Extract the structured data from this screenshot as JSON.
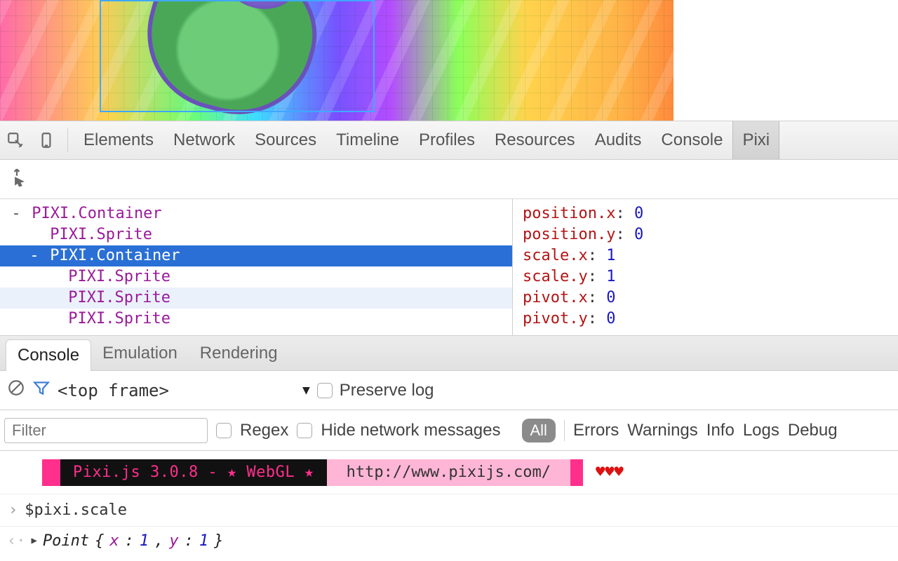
{
  "tabs": {
    "elements": "Elements",
    "network": "Network",
    "sources": "Sources",
    "timeline": "Timeline",
    "profiles": "Profiles",
    "resources": "Resources",
    "audits": "Audits",
    "console": "Console",
    "pixi": "Pixi"
  },
  "tree": [
    {
      "indent": 0,
      "toggle": "-",
      "label": "PIXI.Container",
      "state": ""
    },
    {
      "indent": 1,
      "toggle": " ",
      "label": "PIXI.Sprite",
      "state": ""
    },
    {
      "indent": 1,
      "toggle": "-",
      "label": "PIXI.Container",
      "state": "sel"
    },
    {
      "indent": 2,
      "toggle": " ",
      "label": "PIXI.Sprite",
      "state": ""
    },
    {
      "indent": 2,
      "toggle": " ",
      "label": "PIXI.Sprite",
      "state": "hover"
    },
    {
      "indent": 2,
      "toggle": " ",
      "label": "PIXI.Sprite",
      "state": ""
    }
  ],
  "props": [
    {
      "k": "position.x",
      "v": "0"
    },
    {
      "k": "position.y",
      "v": "0"
    },
    {
      "k": "scale.x",
      "v": "1"
    },
    {
      "k": "scale.y",
      "v": "1"
    },
    {
      "k": "pivot.x",
      "v": "0"
    },
    {
      "k": "pivot.y",
      "v": "0"
    }
  ],
  "drawer_tabs": {
    "console": "Console",
    "emulation": "Emulation",
    "rendering": "Rendering"
  },
  "console_toolbar": {
    "frame": "<top frame>",
    "preserve_log": "Preserve log"
  },
  "console_filters": {
    "filter_placeholder": "Filter",
    "regex": "Regex",
    "hide_net": "Hide network messages",
    "levels": {
      "all": "All",
      "errors": "Errors",
      "warnings": "Warnings",
      "info": "Info",
      "logs": "Logs",
      "debug": "Debug"
    }
  },
  "banner": {
    "version": "Pixi.js 3.0.8 - ★ WebGL ★",
    "url": "http://www.pixijs.com/",
    "hearts": "♥♥♥"
  },
  "prompt": "$pixi.scale",
  "result": {
    "type": "Point ",
    "k1": "x",
    "v1": "1",
    "k2": "y",
    "v2": "1"
  }
}
